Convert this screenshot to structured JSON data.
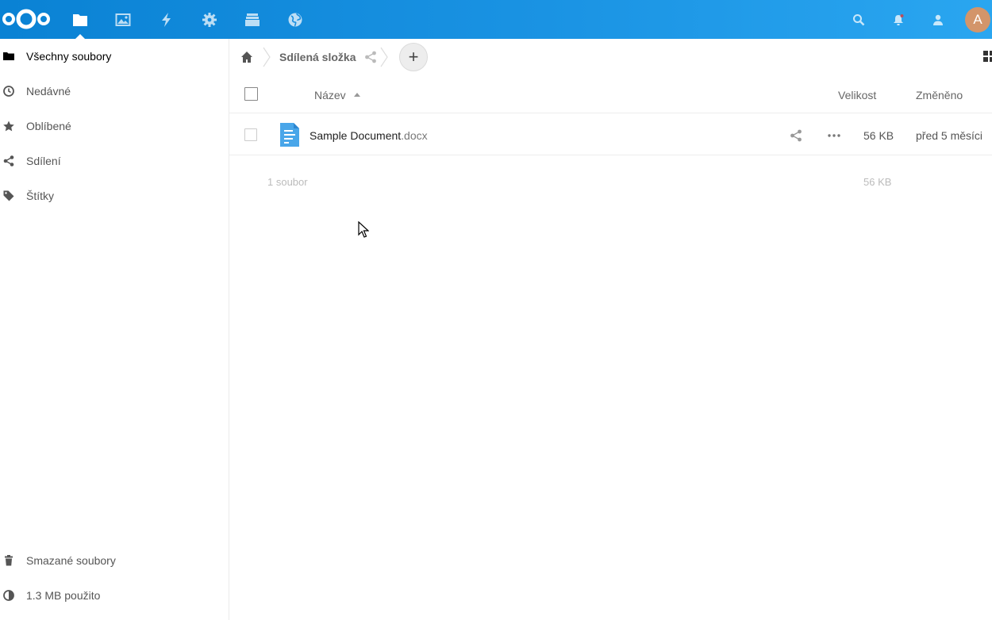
{
  "header": {
    "apps": [
      {
        "name": "files-app",
        "icon": "folder-icon",
        "active": true
      },
      {
        "name": "photos-app",
        "icon": "image-icon"
      },
      {
        "name": "activity-app",
        "icon": "lightning-icon"
      },
      {
        "name": "settings-app",
        "icon": "gear-icon"
      },
      {
        "name": "deck-app",
        "icon": "stack-icon"
      },
      {
        "name": "external-sites-app",
        "icon": "globe-icon"
      }
    ],
    "right_icons": [
      "search-icon",
      "bell-icon",
      "contacts-icon"
    ],
    "avatar_letter": "A",
    "avatar_color": "#d3956a",
    "brand_color": "#0a82d4"
  },
  "sidebar": {
    "items": [
      {
        "label": "Všechny soubory",
        "icon": "folder-icon",
        "active": true
      },
      {
        "label": "Nedávné",
        "icon": "clock-icon"
      },
      {
        "label": "Oblíbené",
        "icon": "star-icon"
      },
      {
        "label": "Sdílení",
        "icon": "share-icon"
      },
      {
        "label": "Štítky",
        "icon": "tag-icon"
      }
    ],
    "trash_label": "Smazané soubory",
    "quota_label": "1.3 MB použito"
  },
  "breadcrumb": {
    "folder": "Sdílená složka",
    "add_label": "+"
  },
  "table": {
    "col_name": "Název",
    "col_size": "Velikost",
    "col_modified": "Změněno"
  },
  "files": [
    {
      "basename": "Sample Document",
      "extension": ".docx",
      "size": "56 KB",
      "modified": "před 5 měsíci"
    }
  ],
  "summary": {
    "count": "1 soubor",
    "size": "56 KB"
  }
}
